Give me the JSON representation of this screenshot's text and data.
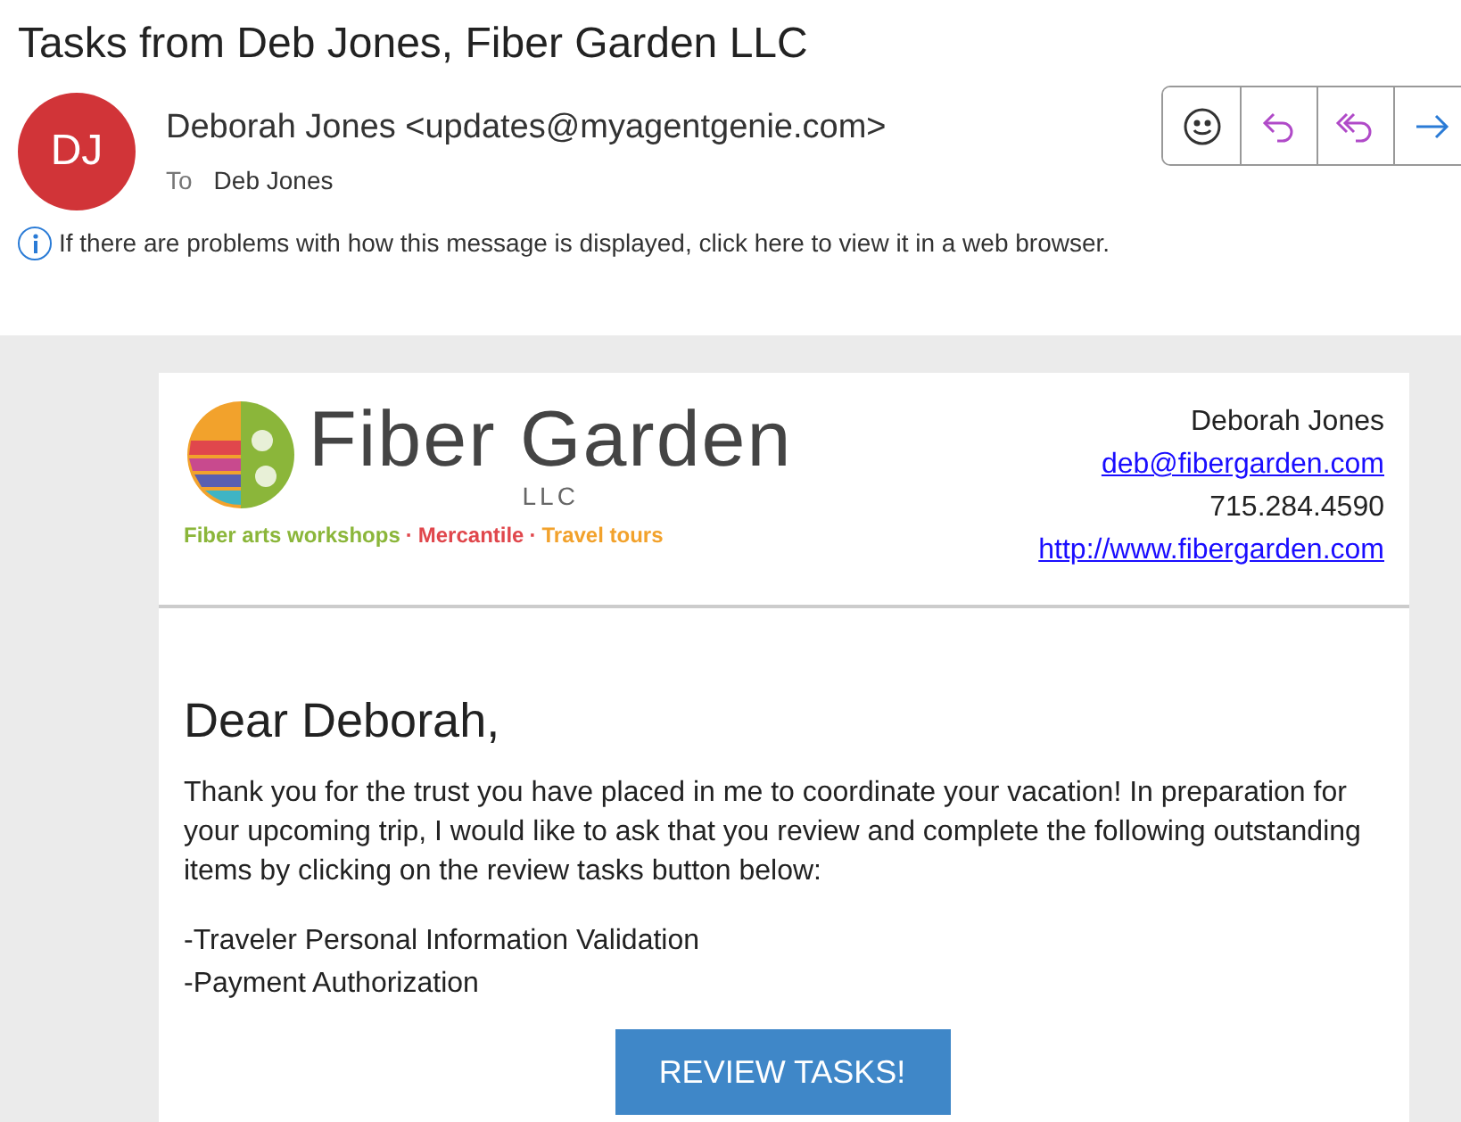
{
  "subject": "Tasks from Deb Jones, Fiber Garden LLC",
  "sender": {
    "initials": "DJ",
    "from": "Deborah Jones <updates@myagentgenie.com>",
    "to_label": "To",
    "to": "Deb Jones"
  },
  "actions": [
    {
      "kind": "emoji"
    },
    {
      "kind": "reply"
    },
    {
      "kind": "reply_all"
    },
    {
      "kind": "forward"
    }
  ],
  "info_bar": "If there are problems with how this message is displayed, click here to view it in a web browser.",
  "logo": {
    "name": "Fiber Garden",
    "suffix": "LLC",
    "separator": "·",
    "tagline": [
      {
        "text": "Fiber arts workshops",
        "color": "#8bb63a"
      },
      {
        "text": "Mercantile",
        "color": "#e0474c"
      },
      {
        "text": "Travel tours",
        "color": "#f2a22c"
      }
    ]
  },
  "contact": [
    {
      "text": "Deborah Jones",
      "kind": "text"
    },
    {
      "text": "deb@fibergarden.com",
      "kind": "link"
    },
    {
      "text": "715.284.4590",
      "kind": "text"
    },
    {
      "text": "http://www.fibergarden.com",
      "kind": "link"
    }
  ],
  "greeting": "Dear Deborah,",
  "body": "Thank you for the trust you have placed in me to coordinate your vacation! In preparation for your upcoming trip, I would like to ask that you review and complete the following outstanding items by clicking on the review tasks button below:",
  "items": [
    "-Traveler Personal Information Validation",
    "-Payment Authorization"
  ],
  "button": "REVIEW TASKS!"
}
